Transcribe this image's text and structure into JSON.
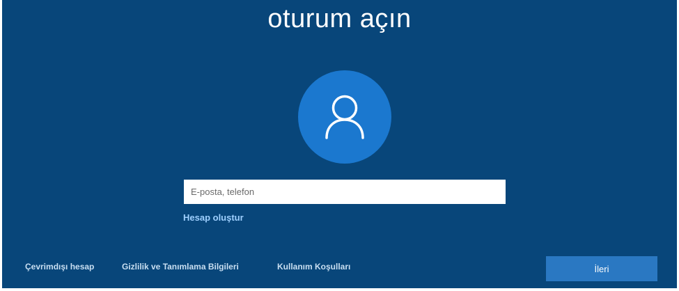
{
  "page": {
    "title": "oturum açın"
  },
  "avatar": {
    "icon": "user-icon",
    "circle_color": "#1b78cf"
  },
  "signin": {
    "email_placeholder": "E-posta, telefon",
    "email_value": "",
    "create_account_label": "Hesap oluştur"
  },
  "footer": {
    "offline_account_label": "Çevrimdışı hesap",
    "privacy_label": "Gizlilik ve Tanımlama Bilgileri",
    "terms_label": "Kullanım Koşulları",
    "next_label": "İleri"
  },
  "colors": {
    "background": "#08467a",
    "accent": "#2a78c2",
    "link": "#9fd0ff"
  }
}
